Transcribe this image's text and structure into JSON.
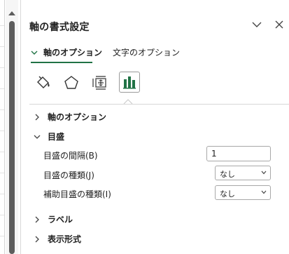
{
  "pane": {
    "title": "軸の書式設定",
    "tabs": [
      {
        "label": "軸のオプション"
      },
      {
        "label": "文字のオプション"
      }
    ]
  },
  "category_icons": [
    "fill-line-icon",
    "effects-pentagon-icon",
    "size-properties-icon",
    "axis-options-barchart-icon"
  ],
  "sections": {
    "axis_options": "軸のオプション",
    "tick_marks": "目盛",
    "labels": "ラベル",
    "number": "表示形式"
  },
  "tick_marks": {
    "interval_label": "目盛の間隔(B)",
    "interval_value": "1",
    "major_label": "目盛の種類(J)",
    "major_value": "なし",
    "minor_label": "補助目盛の種類(I)",
    "minor_value": "なし"
  },
  "colors": {
    "accent": "#217346",
    "scroll_thumb": "#5d5d5d"
  }
}
